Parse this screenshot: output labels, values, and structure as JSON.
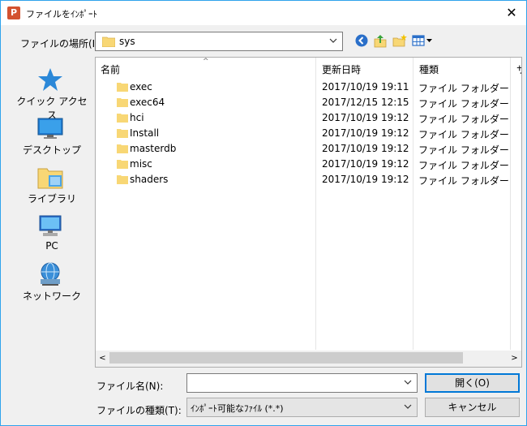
{
  "window": {
    "title": "ファイルをｲﾝﾎﾟｰﾄ",
    "close_glyph": "✕",
    "app_icon_letter": "P"
  },
  "location": {
    "label": "ファイルの場所(I):",
    "value": "sys"
  },
  "places": [
    {
      "label": "クイック アクセス",
      "icon": "star-icon"
    },
    {
      "label": "デスクトップ",
      "icon": "desktop-icon"
    },
    {
      "label": "ライブラリ",
      "icon": "library-icon"
    },
    {
      "label": "PC",
      "icon": "computer-icon"
    },
    {
      "label": "ネットワーク",
      "icon": "network-icon"
    }
  ],
  "columns": {
    "name": "名前",
    "date": "更新日時",
    "type": "種類",
    "size": "サ"
  },
  "files": [
    {
      "name": "exec",
      "date": "2017/10/19 19:11",
      "type": "ファイル フォルダー"
    },
    {
      "name": "exec64",
      "date": "2017/12/15 12:15",
      "type": "ファイル フォルダー"
    },
    {
      "name": "hci",
      "date": "2017/10/19 19:12",
      "type": "ファイル フォルダー"
    },
    {
      "name": "Install",
      "date": "2017/10/19 19:12",
      "type": "ファイル フォルダー"
    },
    {
      "name": "masterdb",
      "date": "2017/10/19 19:12",
      "type": "ファイル フォルダー"
    },
    {
      "name": "misc",
      "date": "2017/10/19 19:12",
      "type": "ファイル フォルダー"
    },
    {
      "name": "shaders",
      "date": "2017/10/19 19:12",
      "type": "ファイル フォルダー"
    }
  ],
  "bottom": {
    "filename_label": "ファイル名(N):",
    "filename_value": "",
    "filetype_label": "ファイルの種類(T):",
    "filetype_value": "ｲﾝﾎﾟｰﾄ可能なﾌｧｲﾙ (*.*)",
    "open_button": "開く(O)",
    "cancel_button": "キャンセル"
  },
  "colors": {
    "window_border": "#2fa3ec",
    "folder": "#f8d775",
    "accent": "#0078d7"
  }
}
